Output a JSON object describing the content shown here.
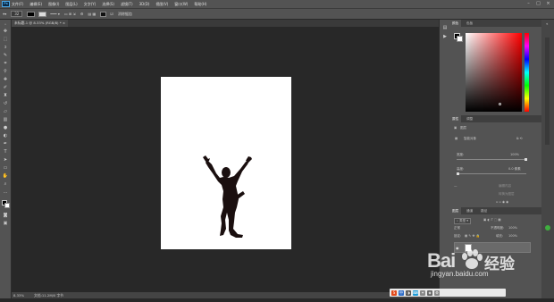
{
  "app": {
    "logo": "Ps"
  },
  "menu": [
    "文件(F)",
    "编辑(E)",
    "图像(I)",
    "图层(L)",
    "文字(Y)",
    "选择(S)",
    "滤镜(T)",
    "3D(D)",
    "视图(V)",
    "窗口(W)",
    "帮助(H)"
  ],
  "options": {
    "tolerance_value": "32",
    "aa_label": "消除锯齿"
  },
  "document": {
    "tab_title": "未标题-1 @ 8.33% (RGB/8) *",
    "zoom": "8.33%",
    "doc_info": "文档:11.2M/0 字节"
  },
  "panels": {
    "color_tabs": [
      "颜色",
      "色板"
    ],
    "props_tabs": [
      "属性",
      "调整"
    ],
    "props_header": "图层",
    "props_smart": "智能对象",
    "props_width_label": "宽度:",
    "props_width_value": "100%",
    "props_height_label": "高度:",
    "props_height_value": "0.0 像素",
    "props_btn_1": "编辑内容",
    "props_btn_2": "转换为图层",
    "layer_tabs": [
      "图层",
      "通道",
      "路径"
    ],
    "layer_filter": "类型",
    "blend_mode": "正常",
    "opacity_label": "不透明度:",
    "opacity_value": "100%",
    "lock_label": "锁定:",
    "fill_label": "填充:",
    "fill_value": "100%"
  },
  "watermark": {
    "brand": "Bai",
    "brand_cn": "经验",
    "url": "jingyan.baidu.com"
  },
  "colors": {
    "silhouette": "#1a0f0f",
    "accent": "#1b6ab3",
    "paw": "#ffffff"
  }
}
